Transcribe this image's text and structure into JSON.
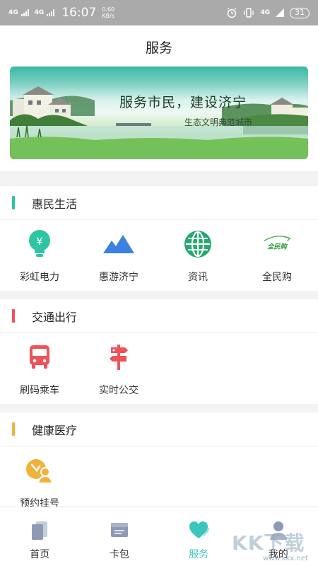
{
  "status_bar": {
    "network_1": "4G",
    "network_2": "4G",
    "time": "16:07",
    "speed_value": "0.60",
    "speed_unit": "KB/s",
    "network_3": "4G",
    "battery": "31"
  },
  "header": {
    "title": "服务"
  },
  "banner": {
    "title": "服务市民，建设济宁",
    "subtitle": "生态文明典范城市"
  },
  "sections": {
    "huimin": {
      "title": "惠民生活",
      "accent": "#2ec5a2",
      "items": [
        {
          "label": "彩虹电力",
          "icon": "lightbulb-icon"
        },
        {
          "label": "惠游济宁",
          "icon": "mountain-icon"
        },
        {
          "label": "资讯",
          "icon": "globe-icon"
        },
        {
          "label": "全民购",
          "icon": "quanmingou-logo-icon"
        }
      ]
    },
    "jiaotong": {
      "title": "交通出行",
      "accent": "#f0525a",
      "items": [
        {
          "label": "刷码乘车",
          "icon": "bus-icon"
        },
        {
          "label": "实时公交",
          "icon": "signpost-icon"
        }
      ]
    },
    "jiankang": {
      "title": "健康医疗",
      "accent": "#f2b23a",
      "items": [
        {
          "label": "预约挂号",
          "icon": "doctor-icon"
        }
      ]
    }
  },
  "quanmingou_logo_text": "全民购",
  "tabbar": {
    "tabs": [
      {
        "label": "首页",
        "icon": "home-icon"
      },
      {
        "label": "卡包",
        "icon": "wallet-icon"
      },
      {
        "label": "服务",
        "icon": "heart-icon",
        "active": true
      },
      {
        "label": "我的",
        "icon": "profile-icon"
      }
    ],
    "active_color": "#3cc4be"
  },
  "watermark": {
    "text": "KK下载",
    "url": "www.kkx.net"
  }
}
